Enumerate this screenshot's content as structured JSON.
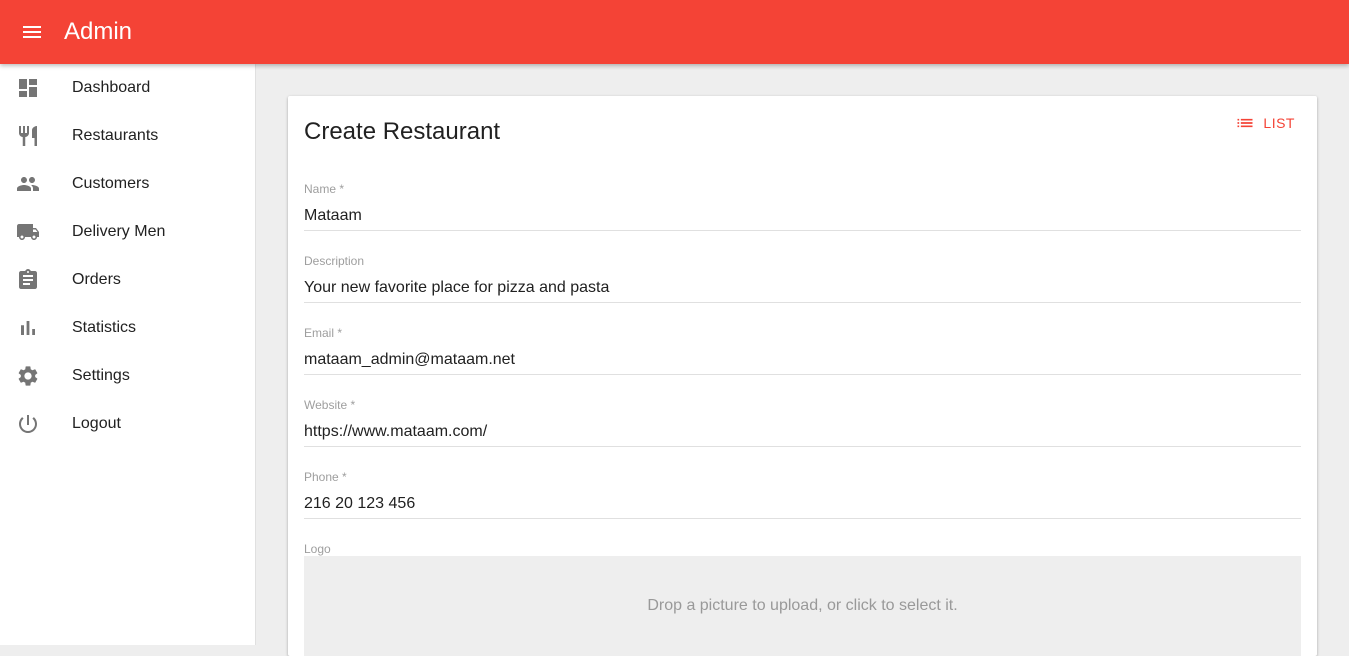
{
  "appbar": {
    "title": "Admin",
    "menu_icon": "menu-icon",
    "color": "#f44336"
  },
  "sidebar": {
    "items": [
      {
        "label": "Dashboard",
        "icon": "dashboard-icon"
      },
      {
        "label": "Restaurants",
        "icon": "restaurant-icon"
      },
      {
        "label": "Customers",
        "icon": "people-icon"
      },
      {
        "label": "Delivery Men",
        "icon": "truck-icon"
      },
      {
        "label": "Orders",
        "icon": "clipboard-icon"
      },
      {
        "label": "Statistics",
        "icon": "bar-chart-icon"
      },
      {
        "label": "Settings",
        "icon": "gear-icon"
      },
      {
        "label": "Logout",
        "icon": "power-icon"
      }
    ]
  },
  "main": {
    "title": "Create Restaurant",
    "list_button": "LIST",
    "fields": {
      "name": {
        "label": "Name *",
        "value": "Mataam"
      },
      "description": {
        "label": "Description",
        "value": "Your new favorite place for pizza and pasta"
      },
      "email": {
        "label": "Email *",
        "value": "mataam_admin@mataam.net"
      },
      "website": {
        "label": "Website *",
        "value": "https://www.mataam.com/"
      },
      "phone": {
        "label": "Phone *",
        "value": "216 20 123 456"
      }
    },
    "logo": {
      "label": "Logo",
      "dropzone_text": "Drop a picture to upload, or click to select it."
    }
  }
}
